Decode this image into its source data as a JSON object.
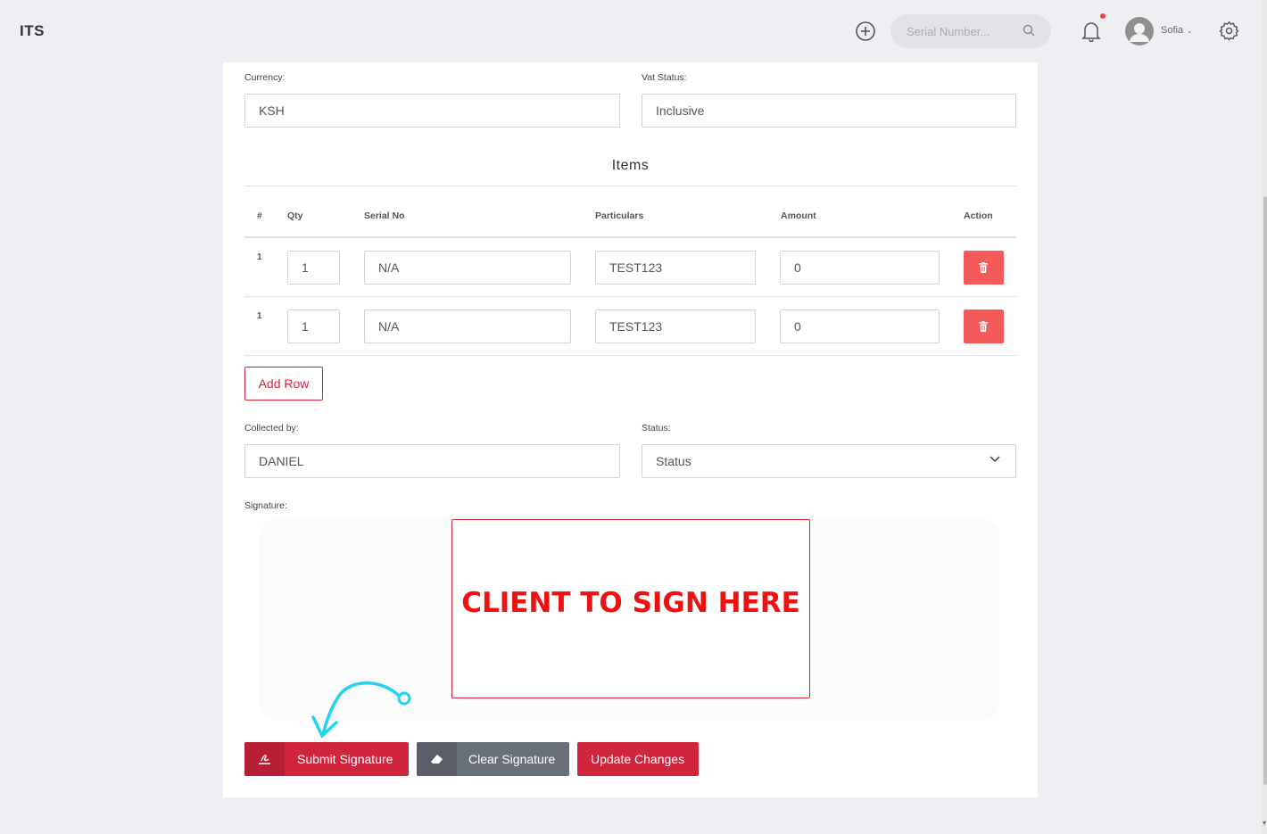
{
  "header": {
    "brand": "ITS",
    "search_placeholder": "Serial Number...",
    "user_name": "Sofia",
    "user_chevron": "⌄"
  },
  "form": {
    "currency": {
      "label": "Currency:",
      "value": "KSH"
    },
    "vat_status": {
      "label": "Vat Status:",
      "value": "Inclusive"
    },
    "items_title": "Items",
    "columns": [
      "#",
      "Qty",
      "Serial No",
      "Particulars",
      "Amount",
      "Action"
    ],
    "rows": [
      {
        "index": "1",
        "qty": "1",
        "serial_no": "N/A",
        "particulars": "TEST123",
        "amount": "0"
      },
      {
        "index": "1",
        "qty": "1",
        "serial_no": "N/A",
        "particulars": "TEST123",
        "amount": "0"
      }
    ],
    "add_row_label": "Add Row",
    "collected_by": {
      "label": "Collected by:",
      "value": "DANIEL"
    },
    "status": {
      "label": "Status:",
      "value": "Status"
    },
    "signature": {
      "label": "Signature:",
      "pad_text": "CLIENT TO SIGN HERE"
    }
  },
  "actions": {
    "submit_signature": "Submit Signature",
    "clear_signature": "Clear Signature",
    "update_changes": "Update Changes"
  },
  "colors": {
    "accent": "#d1243d",
    "delete_button": "#f55a5a",
    "secondary_button": "#6a7079",
    "annotation_arrow": "#22d3ee",
    "sign_text": "#ee1111"
  },
  "icons": [
    "plus-circle-icon",
    "search-icon",
    "bell-icon",
    "avatar-icon",
    "gear-icon",
    "trash-icon",
    "signature-icon",
    "eraser-icon",
    "chevron-down-icon"
  ]
}
